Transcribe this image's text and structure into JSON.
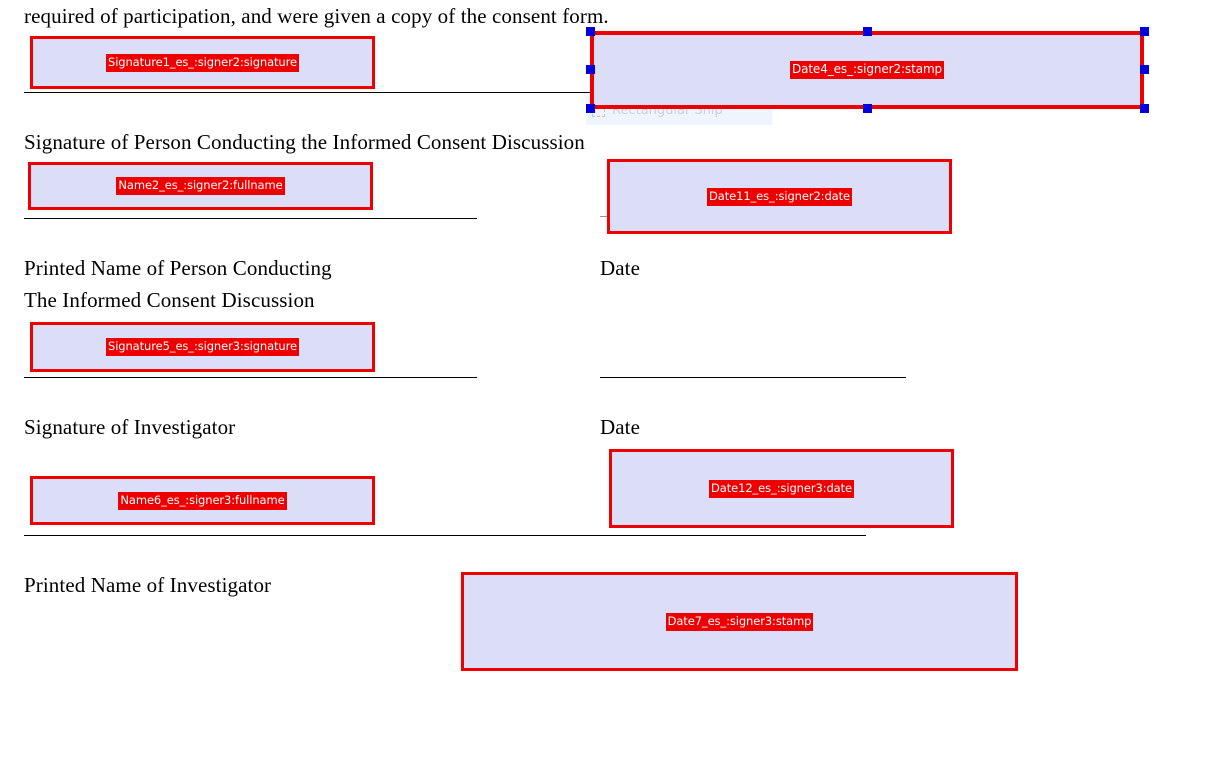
{
  "document": {
    "paragraph_tail": "required of participation, and were given a copy of the consent form.",
    "labels": {
      "signature_conducting": "Signature of Person Conducting the Informed Consent Discussion",
      "printed_name_conducting_line1": "Printed Name of Person Conducting",
      "printed_name_conducting_line2": "The Informed Consent Discussion",
      "date_1": "Date",
      "signature_investigator": "Signature of Investigator",
      "date_2": "Date",
      "printed_name_investigator": "Printed Name of Investigator"
    }
  },
  "colors": {
    "field_border": "#ee0000",
    "field_fill": "#dcdef8",
    "label_background": "#ee0000",
    "label_text": "#ffffff",
    "handle": "#0000dd",
    "rule": "#000000"
  },
  "fields": [
    {
      "id": "signature1",
      "label": "Signature1_es_:signer2:signature",
      "type": "signature",
      "signer": "signer2",
      "selected": false
    },
    {
      "id": "date4",
      "label": "Date4_es_:signer2:stamp",
      "type": "stamp",
      "signer": "signer2",
      "selected": true
    },
    {
      "id": "name2",
      "label": "Name2_es_:signer2:fullname",
      "type": "fullname",
      "signer": "signer2",
      "selected": false
    },
    {
      "id": "date11",
      "label": "Date11_es_:signer2:date",
      "type": "date",
      "signer": "signer2",
      "selected": false
    },
    {
      "id": "signature5",
      "label": "Signature5_es_:signer3:signature",
      "type": "signature",
      "signer": "signer3",
      "selected": false
    },
    {
      "id": "name6",
      "label": "Name6_es_:signer3:fullname",
      "type": "fullname",
      "signer": "signer3",
      "selected": false
    },
    {
      "id": "date12",
      "label": "Date12_es_:signer3:date",
      "type": "date",
      "signer": "signer3",
      "selected": false
    },
    {
      "id": "date7",
      "label": "Date7_es_:signer3:stamp",
      "type": "stamp",
      "signer": "signer3",
      "selected": false
    }
  ],
  "overlay": {
    "snip_tool_label": "Rectangular Snip"
  }
}
